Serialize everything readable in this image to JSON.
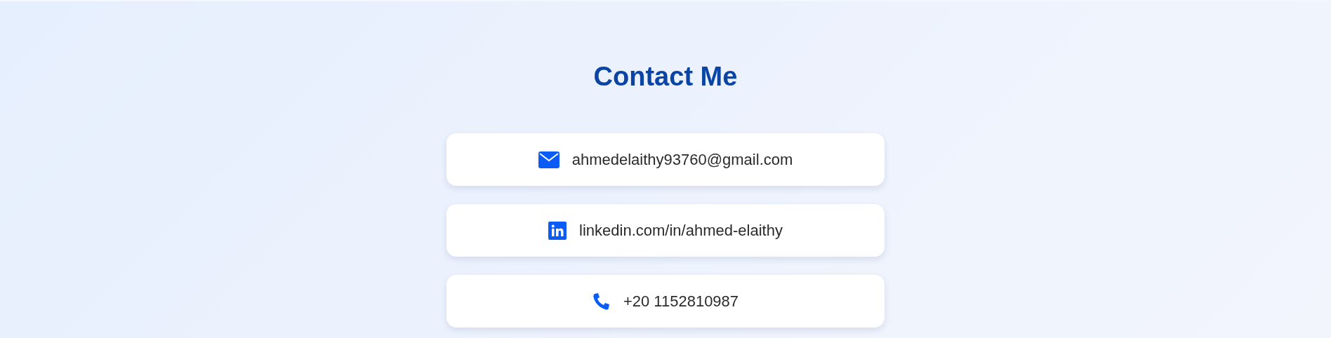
{
  "title": "Contact Me",
  "contacts": [
    {
      "kind": "email",
      "text": "ahmedelaithy93760@gmail.com"
    },
    {
      "kind": "linkedin",
      "text": "linkedin.com/in/ahmed-elaithy"
    },
    {
      "kind": "phone",
      "text": "+20 1152810987"
    }
  ]
}
